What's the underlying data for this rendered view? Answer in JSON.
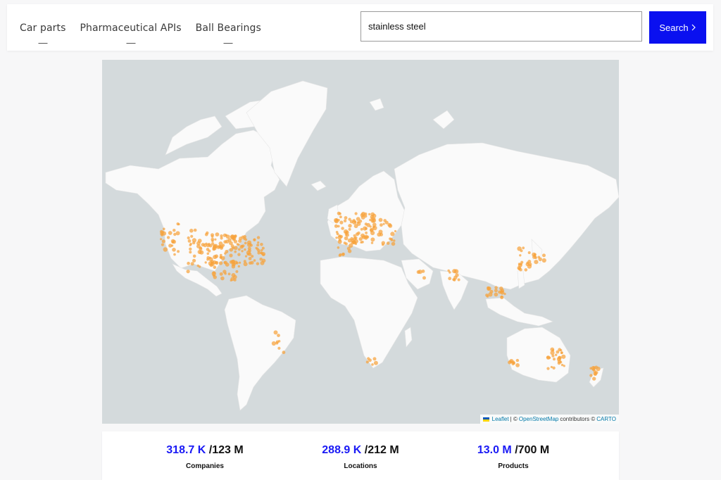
{
  "header": {
    "tags": [
      {
        "label": "Car parts"
      },
      {
        "label": "Pharmaceutical APIs"
      },
      {
        "label": "Ball Bearings"
      }
    ],
    "search": {
      "value": "stainless steel",
      "button_label": "Search",
      "button_icon": "chevron-right-icon"
    },
    "accent_color": "#0a10f0"
  },
  "map": {
    "ocean_color": "#d4dadc",
    "land_color": "#fafafa",
    "marker_color": "#f7a23b",
    "attribution": {
      "leaflet": "Leaflet",
      "sep1": "| ©",
      "osm": "OpenStreetMap",
      "contributors": "contributors ©",
      "carto": "CARTO"
    }
  },
  "stats": [
    {
      "value": "318.7 K",
      "sep": "/",
      "total": "123 M",
      "label": "Companies"
    },
    {
      "value": "288.9 K",
      "sep": "/",
      "total": "212 M",
      "label": "Locations"
    },
    {
      "value": "13.0 M",
      "sep": "/",
      "total": "700 M",
      "label": "Products"
    }
  ]
}
